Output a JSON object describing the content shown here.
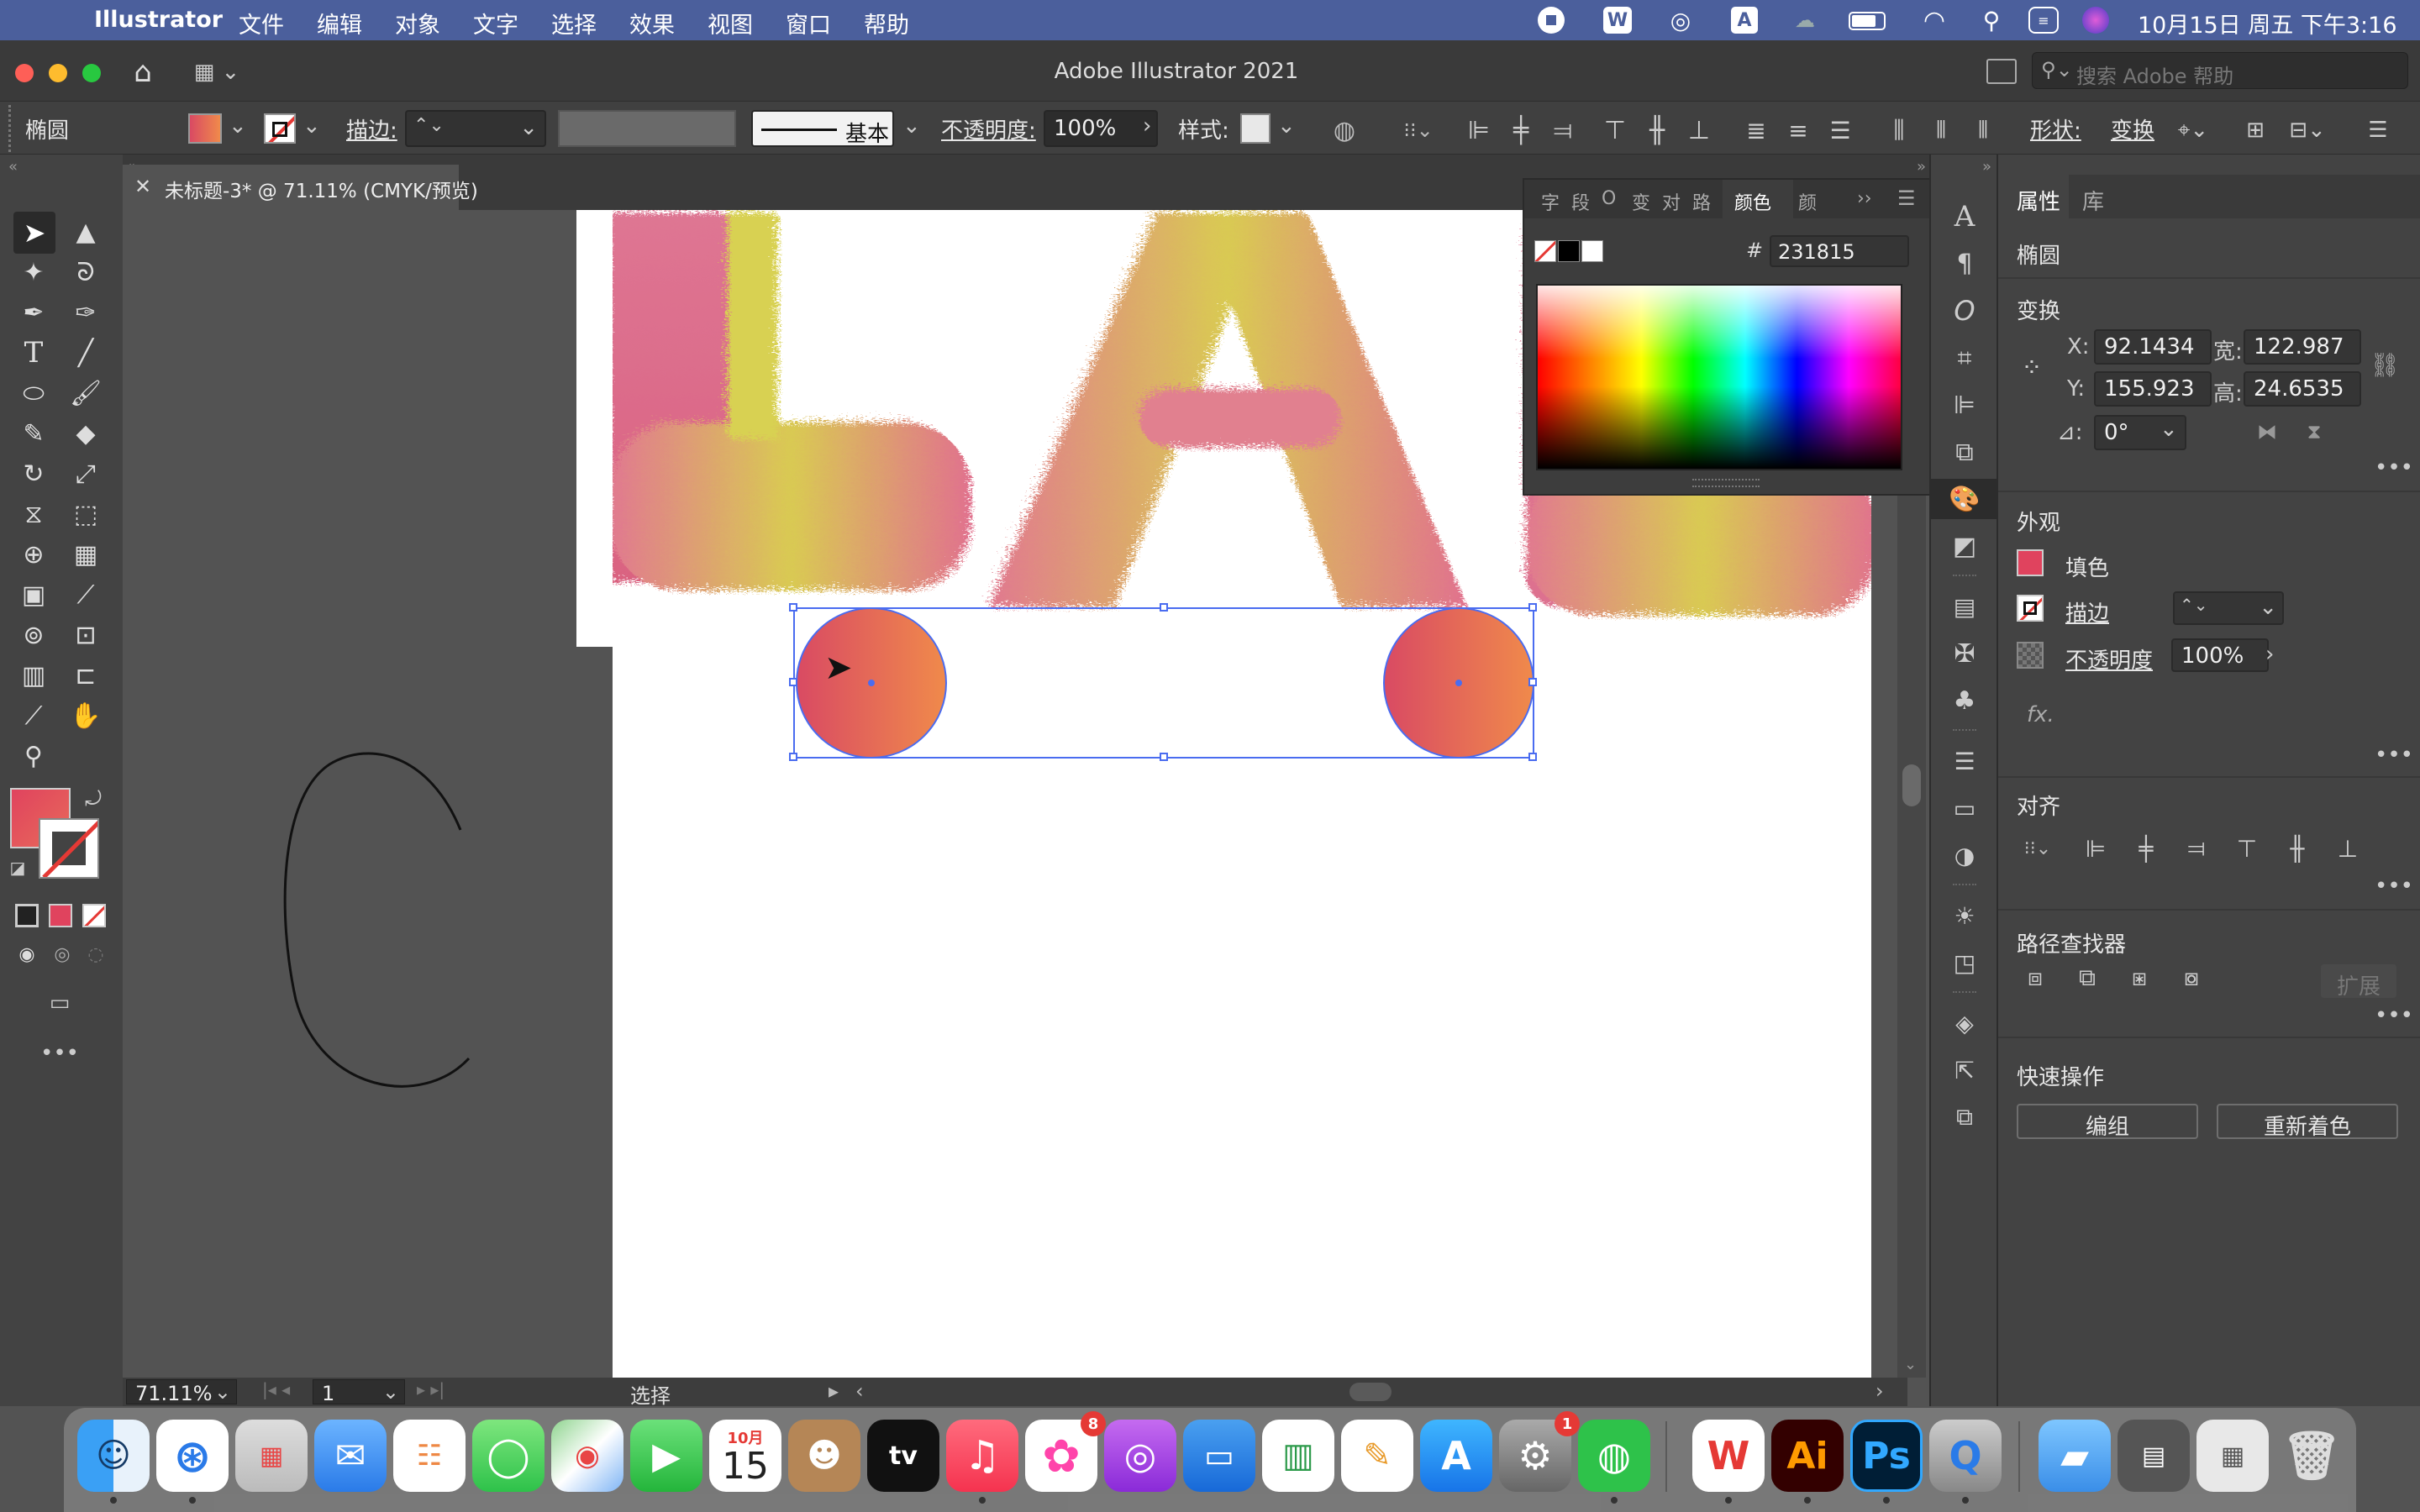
{
  "menubar": {
    "app": "Illustrator",
    "items": [
      "文件",
      "编辑",
      "对象",
      "文字",
      "选择",
      "效果",
      "视图",
      "窗口",
      "帮助"
    ],
    "clock": "10月15日 周五 下午3:16"
  },
  "titlebar": {
    "title": "Adobe Illustrator 2021",
    "search_placeholder": "搜索 Adobe 帮助"
  },
  "control": {
    "object": "椭圆",
    "stroke_label": "描边:",
    "brush": "基本",
    "opacity_label": "不透明度:",
    "opacity": "100%",
    "style_label": "样式:",
    "shape_label": "形状:",
    "transform_label": "变换"
  },
  "document": {
    "tab_title": "未标题-3* @ 71.11% (CMYK/预览)"
  },
  "status": {
    "zoom": "71.11%",
    "page": "1",
    "tool": "选择"
  },
  "color_panel": {
    "tabs": [
      "字",
      "段",
      "O",
      "变",
      "对",
      "路",
      "颜色",
      "颜"
    ],
    "active_tab": "颜色",
    "hex_label": "#",
    "hex": "231815"
  },
  "properties": {
    "tabs": [
      "属性",
      "库"
    ],
    "object": "椭圆",
    "transform": {
      "title": "变换",
      "x_label": "X:",
      "x": "92.1434",
      "y_label": "Y:",
      "y": "155.923",
      "w_label": "宽:",
      "w": "122.987",
      "h_label": "高:",
      "h": "24.6535",
      "angle_label": "⊿:",
      "angle": "0°"
    },
    "appearance": {
      "title": "外观",
      "fill": "填色",
      "stroke": "描边",
      "opacity_label": "不透明度",
      "opacity": "100%",
      "fx": "fx."
    },
    "align": {
      "title": "对齐"
    },
    "pathfinder": {
      "title": "路径查找器",
      "expand": "扩展"
    },
    "quick": {
      "title": "快速操作",
      "group": "编组",
      "recolor": "重新着色"
    }
  },
  "dock": {
    "calendar_month": "10月",
    "calendar_day": "15",
    "music_badge": "8",
    "settings_badge": "1"
  },
  "colors": {
    "menubar": "#4b5f9c",
    "fill_gradient_start": "#d94a63",
    "fill_gradient_end": "#f08a4b",
    "selection": "#4a6cf0"
  }
}
